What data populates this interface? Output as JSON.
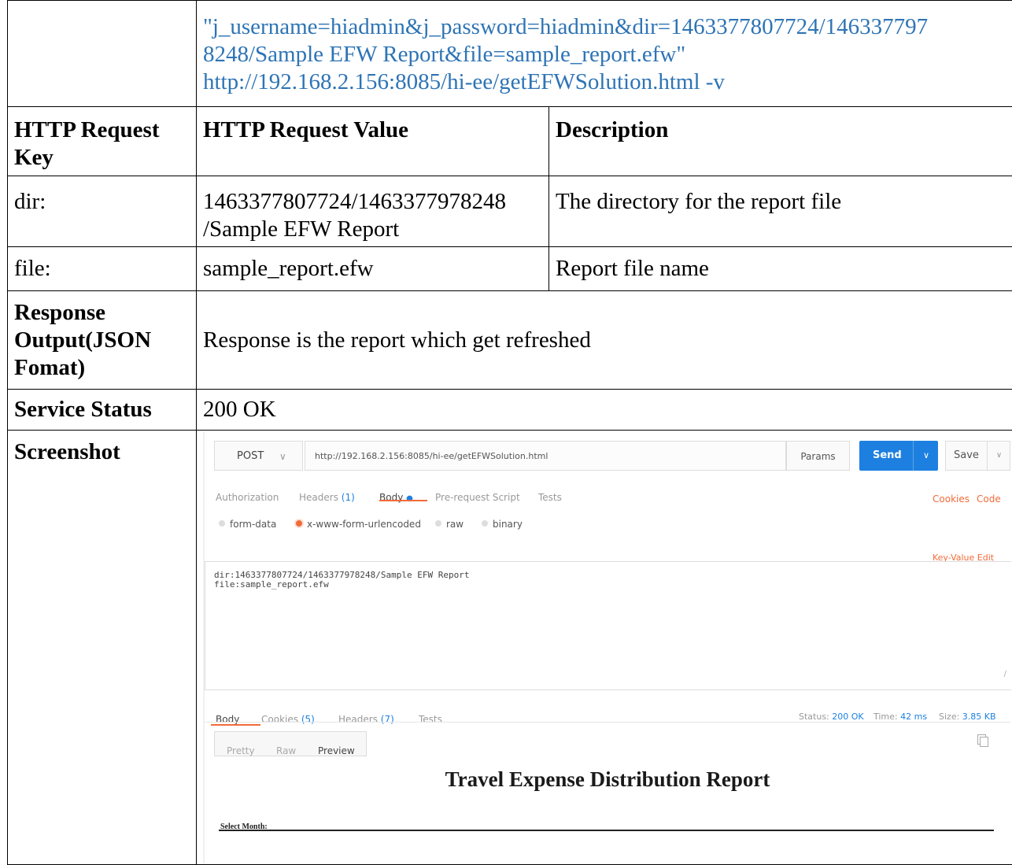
{
  "curl_command": [
    "\"j_username=hiadmin&j_password=hiadmin&dir=1463377807724/146337797",
    "8248/Sample EFW Report&file=sample_report.efw\"",
    "http://192.168.2.156:8085/hi-ee/getEFWSolution.html -v"
  ],
  "table": {
    "headers": [
      "HTTP Request Key",
      "HTTP Request Value",
      "Description"
    ],
    "rows": [
      {
        "key": "dir:",
        "value": "1463377807724/1463377978248\n/Sample EFW Report",
        "description": "The directory for the report file"
      },
      {
        "key": "file:",
        "value": "sample_report.efw",
        "description": "Report file name"
      }
    ],
    "response_label": "Response Output(JSON Fomat)",
    "response_value": "Response is the report which get refreshed",
    "status_label": "Service Status",
    "status_value": "200 OK",
    "screenshot_label": "Screenshot"
  },
  "postman": {
    "method": "POST",
    "url": "http://192.168.2.156:8085/hi-ee/getEFWSolution.html",
    "params_label": "Params",
    "send_label": "Send",
    "save_label": "Save",
    "request_tabs": {
      "authorization": "Authorization",
      "headers": "Headers",
      "headers_count": "(1)",
      "body": "Body",
      "body_dot": "●",
      "prerequest": "Pre-request Script",
      "tests": "Tests",
      "cookies": "Cookies",
      "code": "Code"
    },
    "body_types": [
      "form-data",
      "x-www-form-urlencoded",
      "raw",
      "binary"
    ],
    "selected_body_type": "x-www-form-urlencoded",
    "key_value_edit": "Key-Value Edit",
    "body_lines": [
      "dir:1463377807724/1463377978248/Sample EFW Report",
      "file:sample_report.efw"
    ],
    "response_tabs": {
      "body": "Body",
      "cookies": "Cookies",
      "cookies_count": "(5)",
      "headers": "Headers",
      "headers_count": "(7)",
      "tests": "Tests"
    },
    "status": {
      "status_label": "Status:",
      "status_value": "200 OK",
      "time_label": "Time:",
      "time_value": "42 ms",
      "size_label": "Size:",
      "size_value": "3.85 KB"
    },
    "view_modes": [
      "Pretty",
      "Raw",
      "Preview"
    ],
    "selected_view": "Preview",
    "report_title": "Travel Expense Distribution Report",
    "select_month_label": "Select Month:"
  },
  "colors": {
    "accent_blue": "#1d80e0",
    "accent_orange": "#f26b3a",
    "link_blue": "#2e74b5"
  }
}
